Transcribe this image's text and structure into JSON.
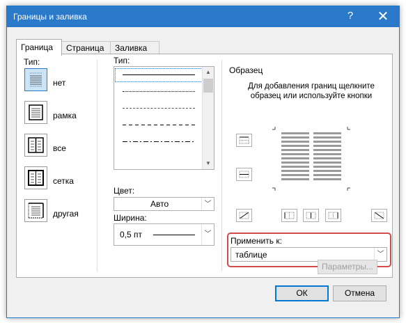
{
  "window": {
    "title": "Границы и заливка",
    "help_glyph": "?",
    "close_glyph": "✕"
  },
  "tabs": [
    {
      "label": "Граница",
      "active": true
    },
    {
      "label": "Страница",
      "active": false
    },
    {
      "label": "Заливка",
      "active": false
    }
  ],
  "type_section": {
    "label": "Тип:",
    "options": [
      {
        "label": "нет",
        "icon": "border-none-icon",
        "selected": true
      },
      {
        "label": "рамка",
        "icon": "border-box-icon",
        "selected": false
      },
      {
        "label": "все",
        "icon": "border-all-icon",
        "selected": false
      },
      {
        "label": "сетка",
        "icon": "border-grid-icon",
        "selected": false
      },
      {
        "label": "другая",
        "icon": "border-custom-icon",
        "selected": false
      }
    ]
  },
  "style_section": {
    "label": "Тип:",
    "line_styles": [
      "solid",
      "dotted",
      "dashed-fine",
      "dashed",
      "dash-dot"
    ],
    "color_label": "Цвет:",
    "color_value": "Авто",
    "width_label": "Ширина:",
    "width_value": "0,5 пт"
  },
  "preview_section": {
    "label": "Образец",
    "hint": "Для добавления границ щелкните образец или используйте кнопки",
    "apply_label": "Применить к:",
    "apply_value": "таблице",
    "options_button": "Параметры..."
  },
  "footer": {
    "ok_label": "ОК",
    "cancel_label": "Отмена"
  },
  "colors": {
    "titlebar": "#2b79c9",
    "highlight": "#d34a4a",
    "selection": "#cce4f7"
  }
}
